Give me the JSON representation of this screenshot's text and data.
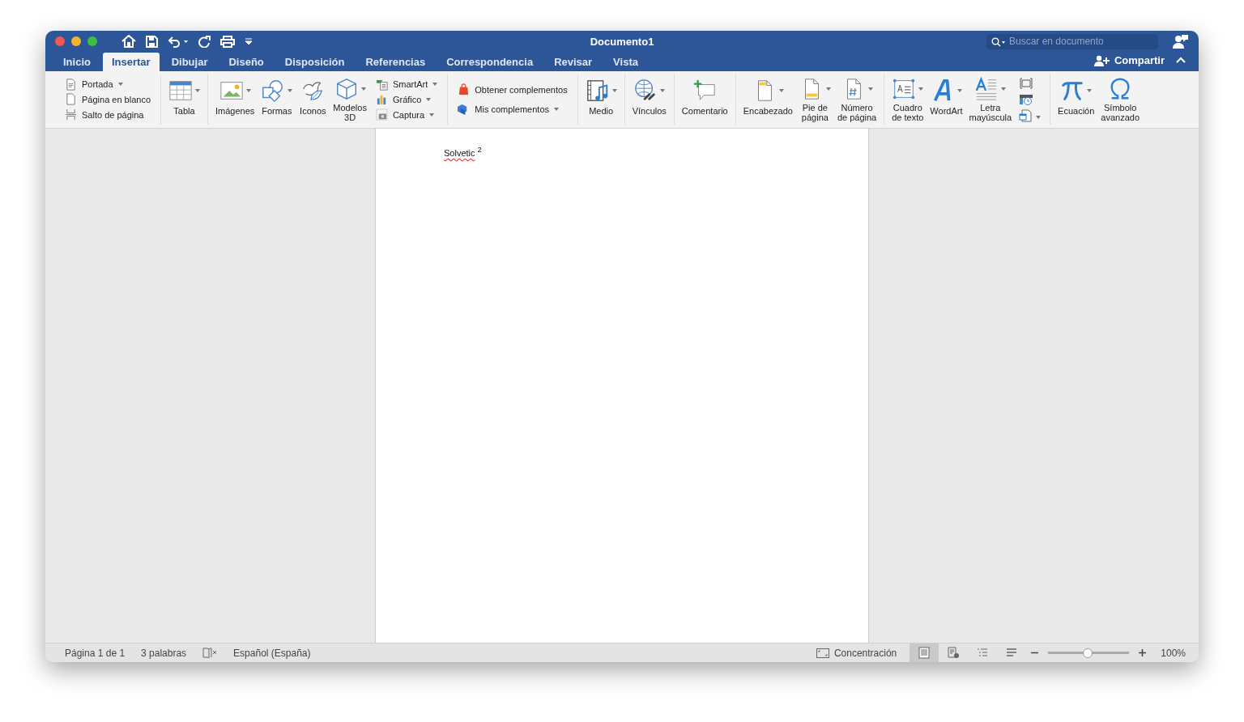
{
  "window": {
    "title": "Documento1"
  },
  "search": {
    "placeholder": "Buscar en documento"
  },
  "tabs": [
    {
      "label": "Inicio",
      "selected": false
    },
    {
      "label": "Insertar",
      "selected": true
    },
    {
      "label": "Dibujar",
      "selected": false
    },
    {
      "label": "Diseño",
      "selected": false
    },
    {
      "label": "Disposición",
      "selected": false
    },
    {
      "label": "Referencias",
      "selected": false
    },
    {
      "label": "Correspondencia",
      "selected": false
    },
    {
      "label": "Revisar",
      "selected": false
    },
    {
      "label": "Vista",
      "selected": false
    }
  ],
  "share_button": {
    "label": "Compartir"
  },
  "ribbon": {
    "groups": [
      {
        "items": [
          {
            "kind": "small",
            "label": "Portada",
            "dropdown": true
          },
          {
            "kind": "small",
            "label": "Página en blanco",
            "dropdown": false
          },
          {
            "kind": "small",
            "label": "Salto de página",
            "dropdown": false
          }
        ]
      },
      {
        "items": [
          {
            "kind": "large",
            "label": "Tabla",
            "dropdown": true
          }
        ]
      },
      {
        "items": [
          {
            "kind": "large",
            "label": "Imágenes",
            "dropdown": true
          },
          {
            "kind": "large",
            "label": "Formas",
            "dropdown": true
          },
          {
            "kind": "large",
            "label": "Iconos",
            "dropdown": false
          },
          {
            "kind": "large",
            "label": "Modelos\n3D",
            "dropdown": true
          },
          {
            "kind": "small",
            "label": "SmartArt",
            "dropdown": true
          },
          {
            "kind": "small",
            "label": "Gráfico",
            "dropdown": true
          },
          {
            "kind": "small",
            "label": "Captura",
            "dropdown": true
          }
        ]
      },
      {
        "items": [
          {
            "kind": "small",
            "label": "Obtener complementos",
            "dropdown": false
          },
          {
            "kind": "small",
            "label": "Mis complementos",
            "dropdown": true
          }
        ]
      },
      {
        "items": [
          {
            "kind": "large",
            "label": "Medio",
            "dropdown": true
          }
        ]
      },
      {
        "items": [
          {
            "kind": "large",
            "label": "Vínculos",
            "dropdown": true
          }
        ]
      },
      {
        "items": [
          {
            "kind": "large",
            "label": "Comentario",
            "dropdown": false
          }
        ]
      },
      {
        "items": [
          {
            "kind": "large",
            "label": "Encabezado",
            "dropdown": true
          },
          {
            "kind": "large",
            "label": "Pie de\npágina",
            "dropdown": true
          },
          {
            "kind": "large",
            "label": "Número\nde página",
            "dropdown": true
          }
        ]
      },
      {
        "items": [
          {
            "kind": "large",
            "label": "Cuadro\nde texto",
            "dropdown": true
          },
          {
            "kind": "large",
            "label": "WordArt",
            "dropdown": true
          },
          {
            "kind": "large",
            "label": "Letra\nmayúscula",
            "dropdown": true
          }
        ]
      },
      {
        "items": [
          {
            "kind": "large",
            "label": "Ecuación",
            "dropdown": true
          },
          {
            "kind": "large",
            "label": "Símbolo\navanzado",
            "dropdown": false
          }
        ]
      }
    ]
  },
  "document": {
    "word": "Solvetic",
    "misspelled": true,
    "superscript": "2"
  },
  "status_bar": {
    "page": "Página 1 de 1",
    "words": "3 palabras",
    "language": "Español (España)",
    "focus": "Concentración",
    "views": [
      {
        "selected": true
      },
      {
        "selected": false
      },
      {
        "selected": false
      },
      {
        "selected": false
      }
    ],
    "zoom": {
      "level": 0.5,
      "reading": "100%"
    }
  }
}
